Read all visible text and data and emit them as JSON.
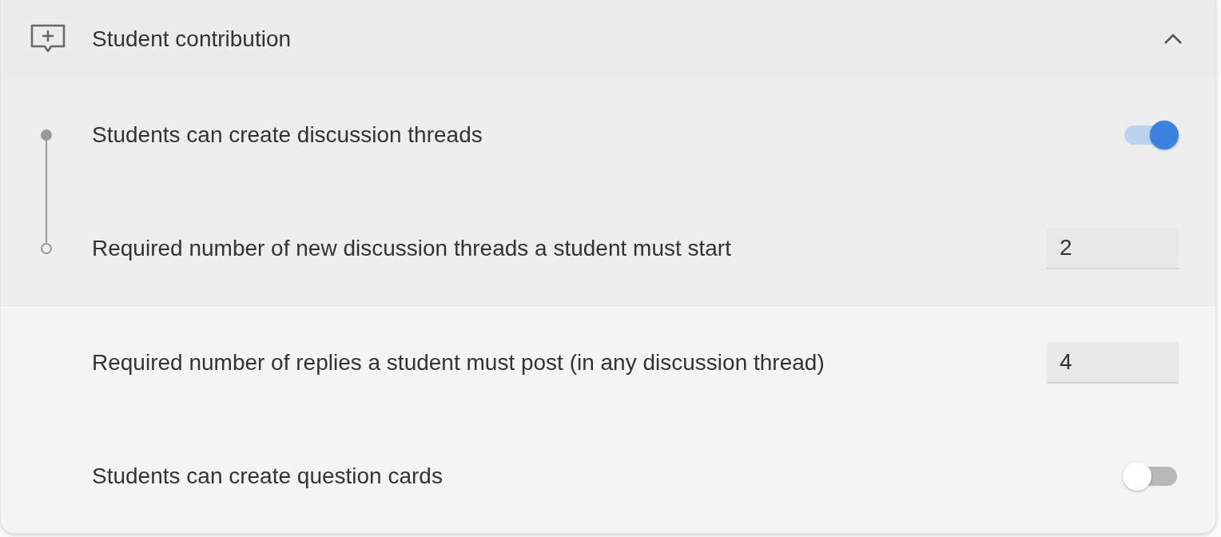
{
  "section": {
    "title": "Student contribution",
    "expanded": true
  },
  "settings": [
    {
      "kind": "toggle",
      "label": "Students can create discussion threads",
      "on": true,
      "children": [
        {
          "kind": "number",
          "label": "Required number of new discussion threads a student must start",
          "value": "2"
        }
      ]
    },
    {
      "kind": "number",
      "label": "Required number of replies a student must post (in any discussion thread)",
      "value": "4"
    },
    {
      "kind": "toggle",
      "label": "Students can create question cards",
      "on": false
    }
  ]
}
